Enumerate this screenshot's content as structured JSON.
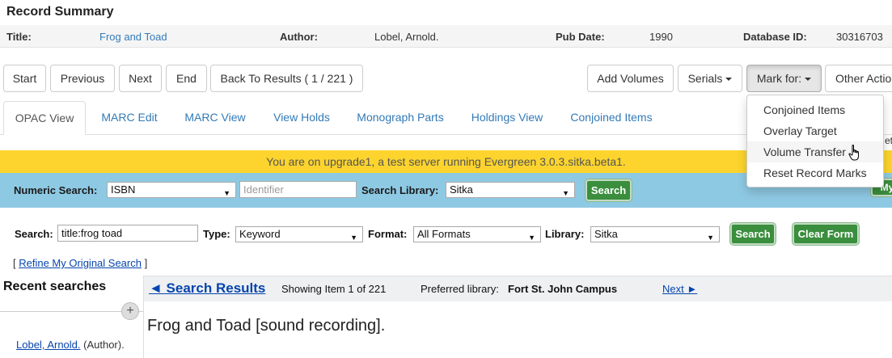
{
  "header": {
    "title": "Record Summary"
  },
  "summary": {
    "title_label": "Title:",
    "title_value": "Frog and Toad",
    "author_label": "Author:",
    "author_value": "Lobel, Arnold.",
    "pubdate_label": "Pub Date:",
    "pubdate_value": "1990",
    "dbid_label": "Database ID:",
    "dbid_value": "30316703"
  },
  "toolbar": {
    "start": "Start",
    "previous": "Previous",
    "next": "Next",
    "end": "End",
    "back": "Back To Results ( 1 / 221 )",
    "add_volumes": "Add Volumes",
    "serials": "Serials",
    "mark_for": "Mark for:",
    "other_actions": "Other Actio"
  },
  "tabs": [
    "OPAC View",
    "MARC Edit",
    "MARC View",
    "View Holds",
    "Monograph Parts",
    "Holdings View",
    "Conjoined Items"
  ],
  "mark_menu": [
    "Conjoined Items",
    "Overlay Target",
    "Volume Transfer",
    "Reset Record Marks"
  ],
  "banner": "You are on upgrade1, a test server running Evergreen 3.0.3.sitka.beta1.",
  "numeric": {
    "label": "Numeric Search:",
    "type_value": "ISBN",
    "identifier_placeholder": "Identifier",
    "library_label": "Search Library:",
    "library_value": "Sitka",
    "button": "Search"
  },
  "search": {
    "label": "Search:",
    "query": "title:frog toad",
    "type_label": "Type:",
    "type_value": "Keyword",
    "format_label": "Format:",
    "format_value": "All Formats",
    "library_label": "Library:",
    "library_value": "Sitka",
    "search_button": "Search",
    "clear_button": "Clear Form"
  },
  "refine": {
    "open": "[ ",
    "link": "Refine My Original Search",
    "close": " ]"
  },
  "recent": {
    "title": "Recent searches"
  },
  "results_nav": {
    "back_link": "◄ Search Results",
    "showing": "Showing Item 1 of 221",
    "pref_label": "Preferred library:",
    "pref_value": "Fort St. John Campus",
    "next": "Next ►"
  },
  "record": {
    "title": "Frog and Toad [sound recording].",
    "author_link": "Lobel, Arnold.",
    "author_role": " (Author)."
  },
  "peek": {
    "behind_menu": "et",
    "my_button": "My"
  }
}
